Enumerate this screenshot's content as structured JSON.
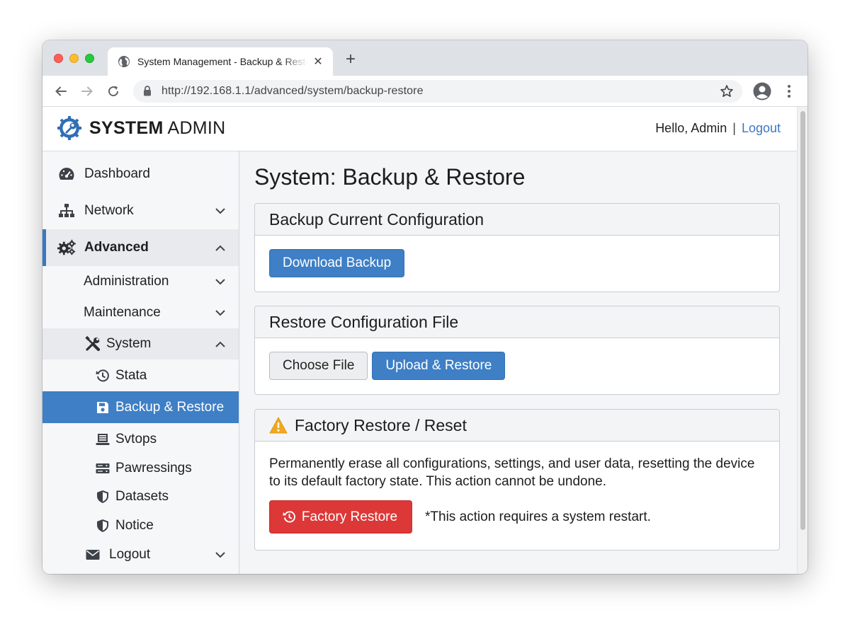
{
  "browser": {
    "tab_title": "System Management - Backup & Restore",
    "url": "http://192.168.1.1/advanced/system/backup-restore",
    "new_tab_symbol": "+",
    "close_tab_symbol": "✕"
  },
  "header": {
    "brand_bold": "SYSTEM",
    "brand_light": " ADMIN",
    "greeting": "Hello, Admin",
    "separator": "|",
    "logout": "Logout"
  },
  "sidebar": {
    "items": [
      {
        "label": "Dashboard",
        "icon": "dashboard-icon"
      },
      {
        "label": "Network",
        "icon": "network-icon"
      },
      {
        "label": "Advanced",
        "icon": "gears-icon"
      },
      {
        "label": "Administration"
      },
      {
        "label": "Maintenance"
      },
      {
        "label": "System",
        "icon": "tools-icon"
      },
      {
        "label": "Stata",
        "icon": "history-icon"
      },
      {
        "label": "Backup & Restore",
        "icon": "floppy-icon"
      },
      {
        "label": "Svtops",
        "icon": "list-icon"
      },
      {
        "label": "Pawressings",
        "icon": "server-icon"
      },
      {
        "label": "Datasets",
        "icon": "shield-icon"
      },
      {
        "label": "Notice",
        "icon": "shield-icon"
      },
      {
        "label": "Logout",
        "icon": "envelope-icon"
      }
    ]
  },
  "main": {
    "title": "System: Backup & Restore",
    "backup": {
      "heading": "Backup Current Configuration",
      "button": "Download Backup"
    },
    "restore": {
      "heading": "Restore Configuration File",
      "choose_button": "Choose File",
      "upload_button": "Upload & Restore"
    },
    "factory": {
      "heading": "Factory Restore / Reset",
      "description": "Permanently erase all configurations, settings, and user data, resetting the device to its default factory state. This action cannot be undone.",
      "button": "Factory Restore",
      "note": "*This action requires a system restart."
    }
  },
  "colors": {
    "accent": "#3e7fc6",
    "danger": "#dc3838",
    "warning": "#f0a91e",
    "link": "#3a78c3"
  }
}
